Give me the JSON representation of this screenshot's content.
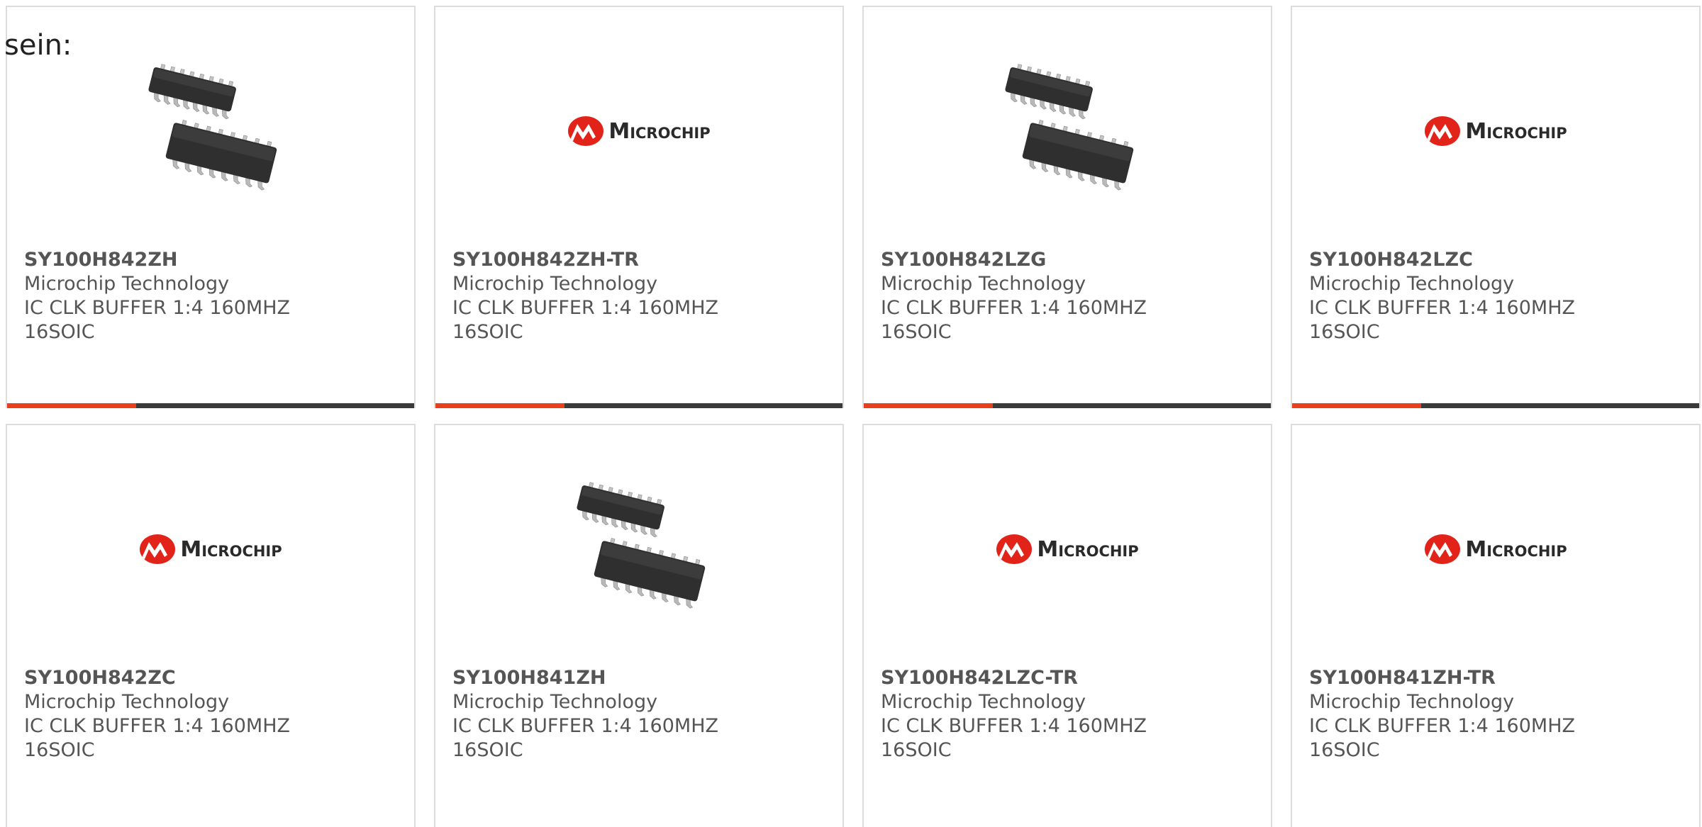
{
  "intro_text": "sein:",
  "colors": {
    "accent_bar": "#e8401c",
    "dark_bar": "#3a3a3a",
    "logo_red": "#e2231a",
    "text": "#555555"
  },
  "logo": {
    "word": "Microchip"
  },
  "cards": [
    {
      "part": "SY100H842ZH",
      "manufacturer": "Microchip Technology",
      "description": "IC CLK BUFFER 1:4 160MHZ 16SOIC",
      "image": "ic-package"
    },
    {
      "part": "SY100H842ZH-TR",
      "manufacturer": "Microchip Technology",
      "description": "IC CLK BUFFER 1:4 160MHZ 16SOIC",
      "image": "microchip-logo"
    },
    {
      "part": "SY100H842LZG",
      "manufacturer": "Microchip Technology",
      "description": "IC CLK BUFFER 1:4 160MHZ 16SOIC",
      "image": "ic-package"
    },
    {
      "part": "SY100H842LZC",
      "manufacturer": "Microchip Technology",
      "description": "IC CLK BUFFER 1:4 160MHZ 16SOIC",
      "image": "microchip-logo"
    },
    {
      "part": "SY100H842ZC",
      "manufacturer": "Microchip Technology",
      "description": "IC CLK BUFFER 1:4 160MHZ 16SOIC",
      "image": "microchip-logo"
    },
    {
      "part": "SY100H841ZH",
      "manufacturer": "Microchip Technology",
      "description": "IC CLK BUFFER 1:4 160MHZ 16SOIC",
      "image": "ic-package"
    },
    {
      "part": "SY100H842LZC-TR",
      "manufacturer": "Microchip Technology",
      "description": "IC CLK BUFFER 1:4 160MHZ 16SOIC",
      "image": "microchip-logo"
    },
    {
      "part": "SY100H841ZH-TR",
      "manufacturer": "Microchip Technology",
      "description": "IC CLK BUFFER 1:4 160MHZ 16SOIC",
      "image": "microchip-logo"
    }
  ]
}
